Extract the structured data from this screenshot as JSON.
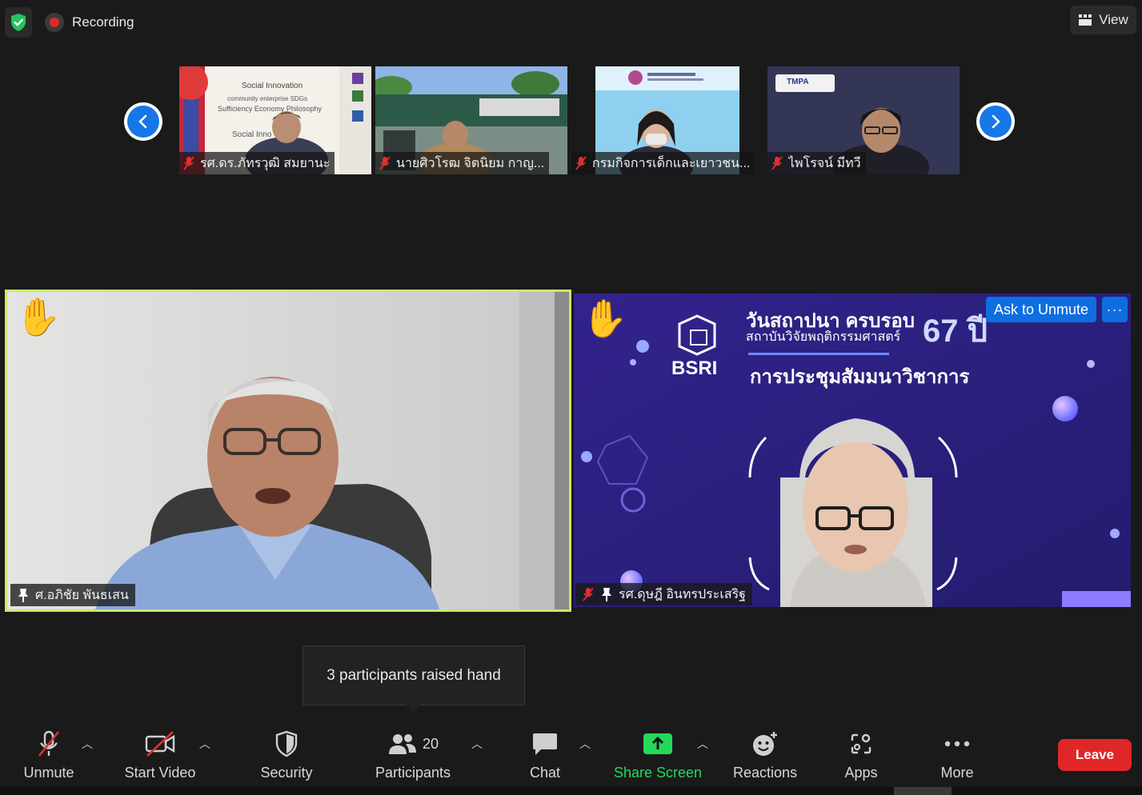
{
  "topbar": {
    "recording_label": "Recording",
    "view_label": "View"
  },
  "thumbnails": [
    {
      "name": "รศ.ดร.ภัทรวุฒิ สมยานะ",
      "slide_line1": "Social Innovation",
      "slide_line2": "community enterprise SDGs",
      "slide_line3": "Sufficiency Economy Philosophy",
      "slide_line4": "Social Inno"
    },
    {
      "name": "นายศิวโรฒ จิตนิยม กาญ..."
    },
    {
      "name": "กรมกิจการเด็กและเยาวชน..."
    },
    {
      "name": "ไพโรจน์ มีทวี",
      "logo": "TMPA"
    }
  ],
  "speakers": [
    {
      "name": "ศ.อภิชัย พันธเสน"
    },
    {
      "name": "รศ.ดุษฎี อินทรประเสริฐ",
      "ask_to_unmute": "Ask to Unmute",
      "more": "···",
      "banner_line1": "วันสถาปนา ครบรอบ",
      "banner_line2": "สถาบันวิจัยพฤติกรรมศาสตร์",
      "banner_years": "67 ปี",
      "banner_logo": "BSRI",
      "banner_title": "การประชุมสัมมนาวิชาการ"
    }
  ],
  "tooltip": {
    "text": "3 participants raised hand"
  },
  "toolbar": {
    "unmute": "Unmute",
    "start_video": "Start Video",
    "security": "Security",
    "participants": "Participants",
    "participants_count": "20",
    "chat": "Chat",
    "share_screen": "Share Screen",
    "reactions": "Reactions",
    "apps": "Apps",
    "more": "More",
    "leave": "Leave"
  },
  "colors": {
    "accent_blue": "#0e6ee0",
    "share_green": "#23d959",
    "leave_red": "#e02727",
    "active_speaker": "#c9e868"
  }
}
